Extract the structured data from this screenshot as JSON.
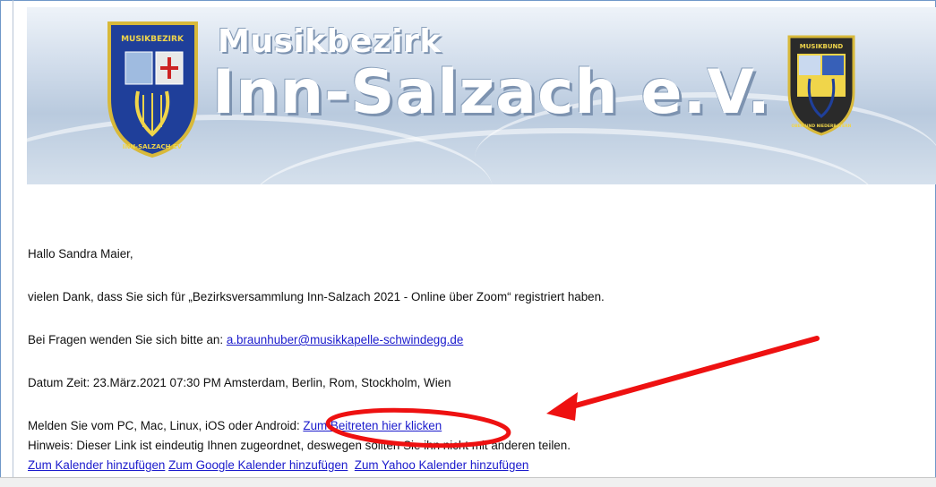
{
  "banner": {
    "title_line1": "Musikbezirk",
    "title_line2": "Inn-Salzach e.V.",
    "left_logo": {
      "top_text": "MUSIKBEZIRK",
      "bottom_text": "INN-SALZACH EV"
    },
    "right_logo": {
      "top_text": "MUSIKBUND",
      "bottom_text": "OBER UND NIEDERBAYERN"
    }
  },
  "email": {
    "greeting": "Hallo Sandra Maier,",
    "thanks": "vielen Dank, dass Sie sich für „Bezirksversammlung Inn-Salzach 2021 - Online über Zoom“ registriert haben.",
    "questions_prefix": "Bei Fragen wenden Sie sich bitte an: ",
    "questions_email": "a.braunhuber@musikkapelle-schwindegg.de",
    "datetime": "Datum Zeit: 23.März.2021 07:30 PM Amsterdam, Berlin, Rom, Stockholm, Wien",
    "join_prefix": "Melden Sie vom PC, Mac, Linux, iOS oder Android: ",
    "join_link": "Zum Beitreten hier klicken",
    "hint": "Hinweis: Dieser Link ist eindeutig Ihnen zugeordnet, deswegen sollten Sie ihn nicht mit anderen teilen.",
    "calendar_links": [
      "Zum Kalender hinzufügen",
      "Zum Google Kalender hinzufügen",
      "Zum Yahoo Kalender hinzufügen"
    ]
  },
  "annotation": {
    "color": "#ee1111"
  }
}
